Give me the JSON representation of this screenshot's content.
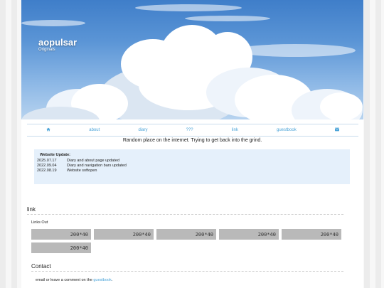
{
  "header": {
    "title": "aopulsar",
    "subtitle": "Originals"
  },
  "nav": {
    "home_icon": "home-icon",
    "items": [
      "about",
      "diary",
      "???",
      "link",
      "guestbook"
    ],
    "mail_icon": "mail-icon"
  },
  "tagline": "Random place on the internet. Trying to get back into the grind.",
  "update": {
    "heading": "Website Update:",
    "entries": [
      {
        "date": "2025.07.17",
        "text": "Diary and about page updated"
      },
      {
        "date": "2022.09.04",
        "text": "Diary and navigation bars updated"
      },
      {
        "date": "2022.08.19",
        "text": "Website softopen"
      }
    ]
  },
  "links_section": {
    "title": "link",
    "subheading": "Links Out",
    "buttons": [
      "200*40",
      "200*40",
      "200*40",
      "200*40",
      "200*40",
      "200*40"
    ]
  },
  "contact": {
    "title": "Contact",
    "text_before": "email or leave a comment on the",
    "link_text": "guestbook",
    "text_after": "."
  },
  "colors": {
    "link": "#4aa3d8",
    "update_bg": "#e5f0fb",
    "placeholder_bg": "#b9b9b9"
  }
}
